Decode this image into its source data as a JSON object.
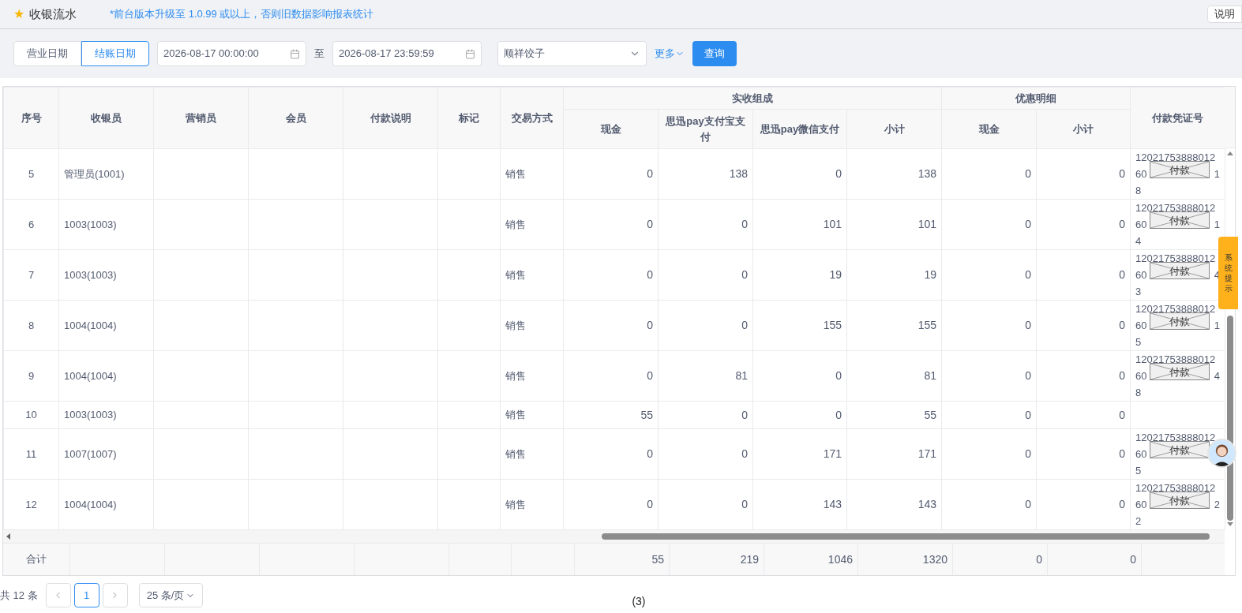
{
  "header": {
    "star": "★",
    "title": "收银流水",
    "notice": "*前台版本升级至 1.0.99 或以上，否则旧数据影响报表统计",
    "help_button": "说明"
  },
  "filters": {
    "date_types": [
      {
        "label": "营业日期",
        "selected": false
      },
      {
        "label": "结账日期",
        "selected": true
      }
    ],
    "start": "2026-08-17 00:00:00",
    "separator": "至",
    "end": "2026-08-17 23:59:59",
    "store": "顺祥饺子",
    "more": "更多",
    "query": "查询"
  },
  "table": {
    "columns": [
      {
        "label": "序号"
      },
      {
        "label": "收银员"
      },
      {
        "label": "营销员"
      },
      {
        "label": "会员"
      },
      {
        "label": "付款说明"
      },
      {
        "label": "标记"
      },
      {
        "label": "交易方式"
      },
      {
        "label": "实收组成",
        "children": [
          "现金",
          "思迅pay支付宝支付",
          "思迅pay微信支付",
          "小计"
        ]
      },
      {
        "label": "优惠明细",
        "children": [
          "现金",
          "小计"
        ]
      },
      {
        "label": "付款凭证号"
      }
    ],
    "rows": [
      {
        "no": "5",
        "cashier": "管理员(1001)",
        "type": "销售",
        "values": [
          "0",
          "138",
          "0",
          "138",
          "0",
          "0"
        ],
        "voucher": {
          "line1": "12021753888012",
          "line2_start": "60",
          "line2_end": "1",
          "line3": "8",
          "attachment": "付款"
        }
      },
      {
        "no": "6",
        "cashier": "1003(1003)",
        "type": "销售",
        "values": [
          "0",
          "0",
          "101",
          "101",
          "0",
          "0"
        ],
        "voucher": {
          "line1": "12021753888012",
          "line2_start": "60",
          "line2_end": "1",
          "line3": "4",
          "attachment": "付款"
        }
      },
      {
        "no": "7",
        "cashier": "1003(1003)",
        "type": "销售",
        "values": [
          "0",
          "0",
          "19",
          "19",
          "0",
          "0"
        ],
        "voucher": {
          "line1": "12021753888012",
          "line2_start": "60",
          "line2_end": "4",
          "line3": "3",
          "attachment": "付款"
        }
      },
      {
        "no": "8",
        "cashier": "1004(1004)",
        "type": "销售",
        "values": [
          "0",
          "0",
          "155",
          "155",
          "0",
          "0"
        ],
        "voucher": {
          "line1": "12021753888012",
          "line2_start": "60",
          "line2_end": "1",
          "line3": "5",
          "attachment": "付款"
        }
      },
      {
        "no": "9",
        "cashier": "1004(1004)",
        "type": "销售",
        "values": [
          "0",
          "81",
          "0",
          "81",
          "0",
          "0"
        ],
        "voucher": {
          "line1": "12021753888012",
          "line2_start": "60",
          "line2_end": "4",
          "line3": "8",
          "attachment": "付款"
        }
      },
      {
        "no": "10",
        "cashier": "1003(1003)",
        "type": "销售",
        "values": [
          "55",
          "0",
          "0",
          "55",
          "0",
          "0"
        ]
      },
      {
        "no": "11",
        "cashier": "1007(1007)",
        "type": "销售",
        "values": [
          "0",
          "0",
          "171",
          "171",
          "0",
          "0"
        ],
        "voucher": {
          "line1": "12021753888012",
          "line2_start": "60",
          "line3": "5",
          "attachment": "付款"
        }
      },
      {
        "no": "12",
        "cashier": "1004(1004)",
        "type": "销售",
        "values": [
          "0",
          "0",
          "143",
          "143",
          "0",
          "0"
        ],
        "voucher": {
          "line1": "12021753888012",
          "line2_start": "60",
          "line2_end": "2",
          "line3": "2",
          "attachment": "付款"
        }
      }
    ],
    "totals": {
      "label": "合计",
      "values": [
        "55",
        "219",
        "1046",
        "1320",
        "0",
        "0"
      ]
    }
  },
  "pagination": {
    "total": "共 12 条",
    "pages": [
      {
        "label": "1",
        "selected": true
      }
    ],
    "page_size": "25 条/页"
  },
  "side_tab": "系统提示",
  "caption": "(3)"
}
